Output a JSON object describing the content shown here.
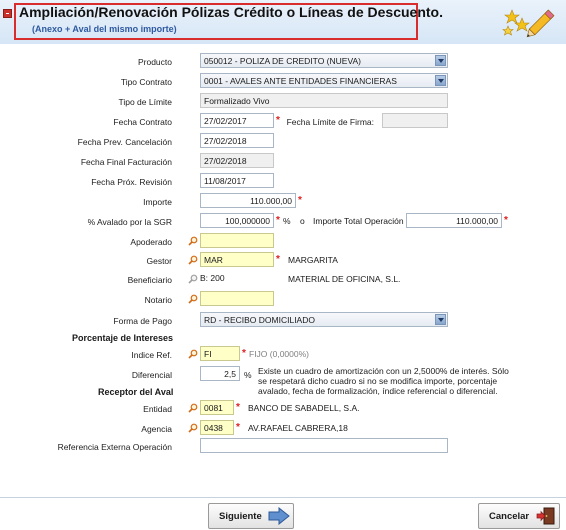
{
  "header": {
    "title": "Ampliación/Renovación Pólizas Crédito o Líneas de Descuento.",
    "subtitle": "(Anexo + Aval del mismo importe)"
  },
  "form": {
    "producto": {
      "label": "Producto",
      "value": "050012 - POLIZA DE CREDITO (NUEVA)"
    },
    "tipo_contrato": {
      "label": "Tipo Contrato",
      "value": "0001 - AVALES ANTE ENTIDADES FINANCIERAS"
    },
    "tipo_limite": {
      "label": "Tipo de Límite",
      "value": "Formalizado Vivo"
    },
    "fecha_contrato": {
      "label": "Fecha Contrato",
      "value": "27/02/2017"
    },
    "fecha_limite_firma": {
      "label": "Fecha Límite de Firma:",
      "value": ""
    },
    "fecha_prev_cancelacion": {
      "label": "Fecha Prev. Cancelación",
      "value": "27/02/2018"
    },
    "fecha_final_facturacion": {
      "label": "Fecha Final Facturación",
      "value": "27/02/2018"
    },
    "fecha_prox_revision": {
      "label": "Fecha Próx. Revisión",
      "value": "11/08/2017"
    },
    "importe": {
      "label": "Importe",
      "value": "110.000,00"
    },
    "avalado": {
      "label": "% Avalado por la SGR",
      "value": "100,000000",
      "unit": "%",
      "connector": "o"
    },
    "importe_total": {
      "label": "Importe Total Operación",
      "value": "110.000,00"
    },
    "apoderado": {
      "label": "Apoderado",
      "value": ""
    },
    "gestor": {
      "label": "Gestor",
      "value": "MAR",
      "desc": "MARGARITA"
    },
    "beneficiario": {
      "label": "Beneficiario",
      "value": "B:      200",
      "desc": "MATERIAL DE OFICINA, S.L."
    },
    "notario": {
      "label": "Notario",
      "value": ""
    },
    "forma_pago": {
      "label": "Forma de Pago",
      "value": "RD - RECIBO DOMICILIADO"
    }
  },
  "intereses": {
    "section": "Porcentaje de Intereses",
    "indice_ref": {
      "label": "Indice Ref.",
      "value": "FI",
      "desc": "FIJO (0,0000%)"
    },
    "diferencial": {
      "label": "Diferencial",
      "value": "2,5",
      "unit": "%",
      "note": "Existe un cuadro de amortización con un 2,5000% de interés. Sólo se respetará dicho cuadro si no se modifica importe, porcentaje avalado, fecha de formalización, índice referencial o diferencial."
    }
  },
  "receptor": {
    "section": "Receptor del Aval",
    "entidad": {
      "label": "Entidad",
      "value": "0081",
      "desc": "BANCO DE SABADELL, S.A."
    },
    "agencia": {
      "label": "Agencia",
      "value": "0438",
      "desc": "AV.RAFAEL CABRERA,18"
    },
    "ref_externa": {
      "label": "Referencia Externa Operación",
      "value": ""
    }
  },
  "buttons": {
    "siguiente": "Siguiente",
    "cancelar": "Cancelar"
  },
  "colors": {
    "required": "#e02020",
    "header_border": "#d92c2c",
    "subtitle": "#2f5aa0",
    "lookup_field": "#ffffc8"
  }
}
